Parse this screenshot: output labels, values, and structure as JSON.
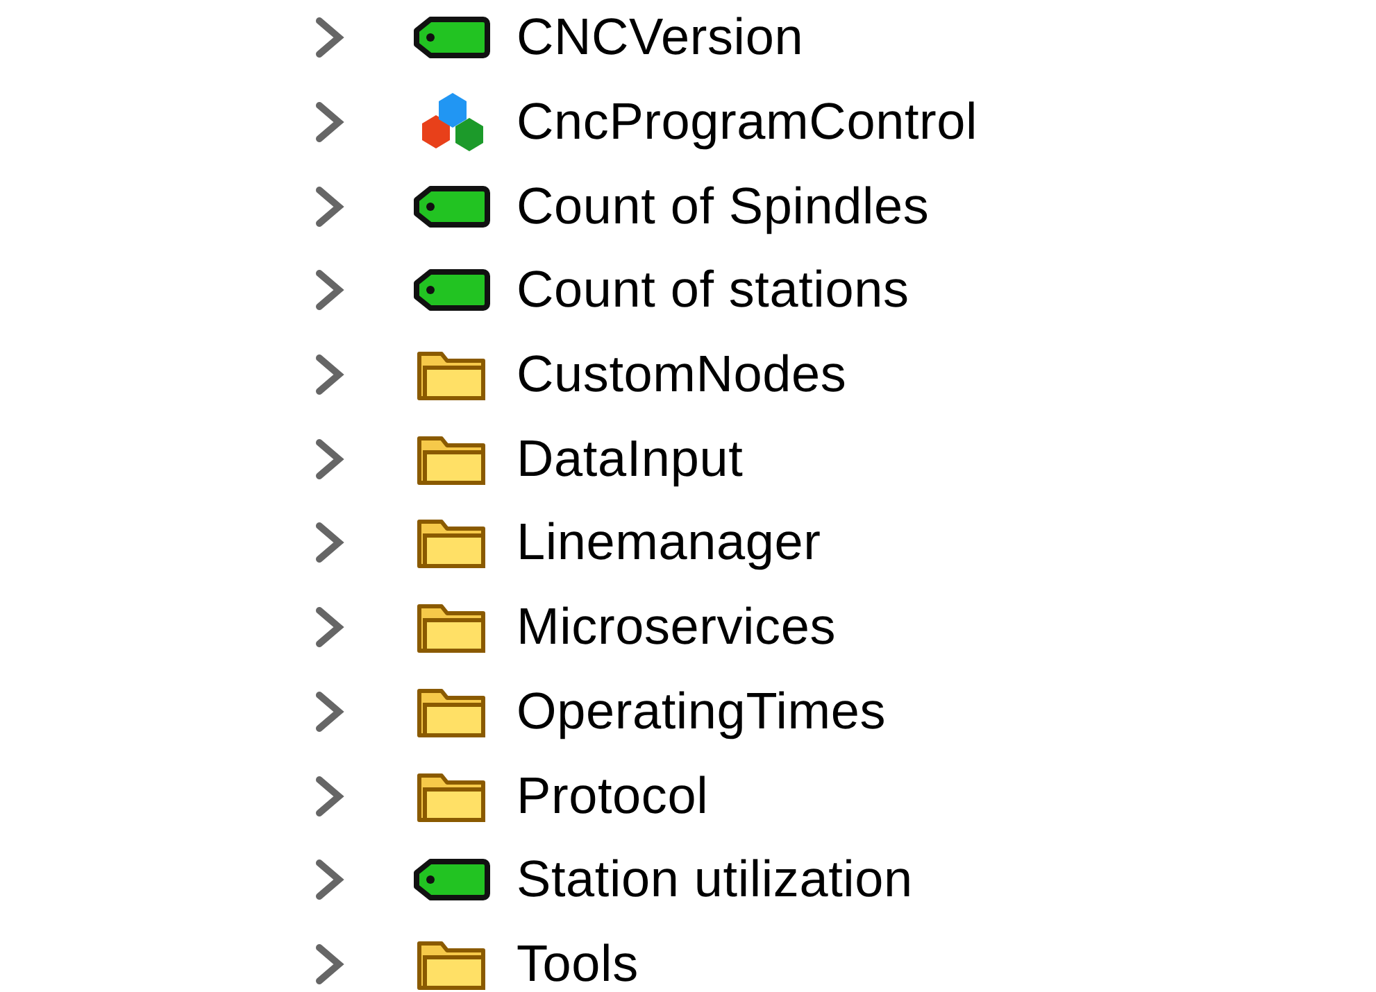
{
  "tree": {
    "items": [
      {
        "label": "CNCVersion",
        "kind": "tag",
        "expanded": false
      },
      {
        "label": "CncProgramControl",
        "kind": "object",
        "expanded": false
      },
      {
        "label": "Count of Spindles",
        "kind": "tag",
        "expanded": false
      },
      {
        "label": "Count of stations",
        "kind": "tag",
        "expanded": false
      },
      {
        "label": "CustomNodes",
        "kind": "folder",
        "expanded": false
      },
      {
        "label": "DataInput",
        "kind": "folder",
        "expanded": false
      },
      {
        "label": "Linemanager",
        "kind": "folder",
        "expanded": false
      },
      {
        "label": "Microservices",
        "kind": "folder",
        "expanded": false
      },
      {
        "label": "OperatingTimes",
        "kind": "folder",
        "expanded": false
      },
      {
        "label": "Protocol",
        "kind": "folder",
        "expanded": false
      },
      {
        "label": "Station utilization",
        "kind": "tag",
        "expanded": false
      },
      {
        "label": "Tools",
        "kind": "folder",
        "expanded": false
      }
    ]
  }
}
